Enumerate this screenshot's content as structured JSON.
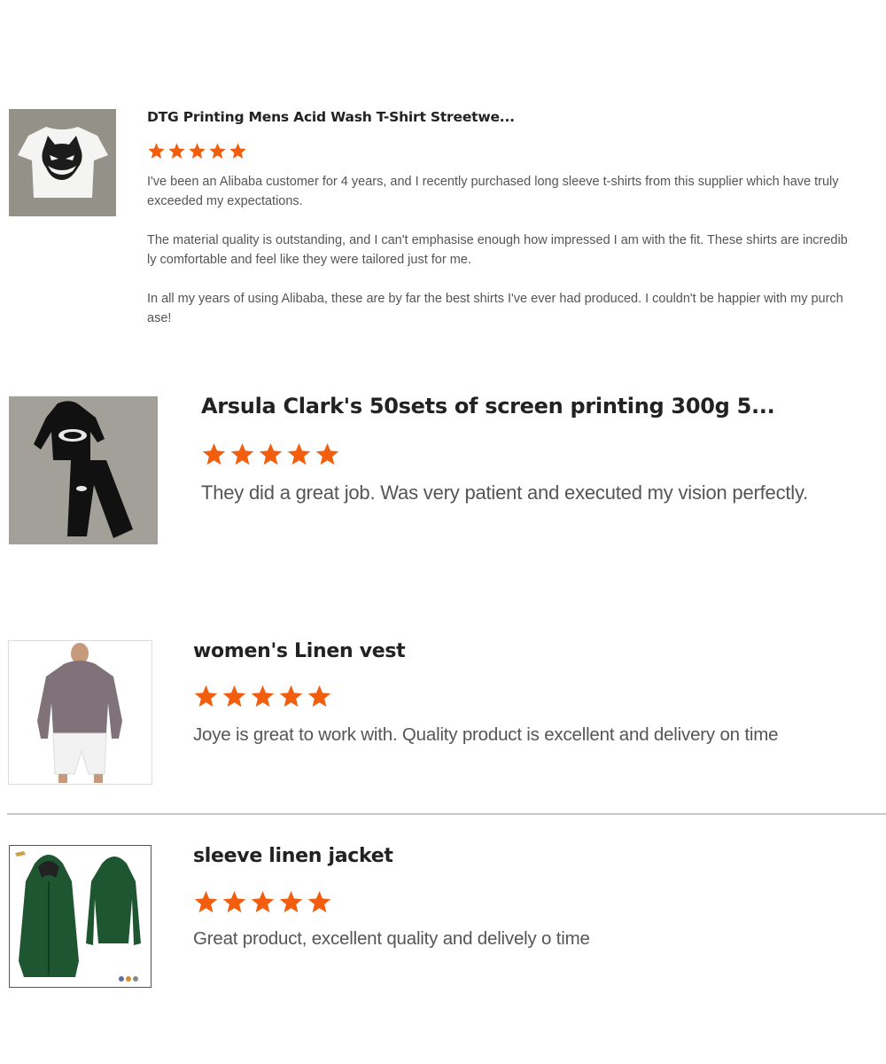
{
  "star_color": "#f25d0e",
  "reviews": [
    {
      "title": "DTG Printing Mens Acid Wash T-Shirt Streetwe...",
      "rating": 5,
      "image": "acid-wash-tshirt-image",
      "paragraphs": [
        "I've been an Alibaba customer for 4 years, and I recently purchased long sleeve t-shirts from this supplier which have truly exceeded my expectations.",
        "The material quality is outstanding, and I can't emphasise enough how impressed I am with the fit. These shirts are incredibly comfortable and feel like they were tailored just for me.",
        "In all my years of using Alibaba, these are by far the best shirts I've ever had produced. I couldn't be happier with my purchase!"
      ]
    },
    {
      "title": "Arsula Clark's 50sets of screen printing 300g 5...",
      "rating": 5,
      "image": "black-tracksuit-image",
      "text": "They did a great job. Was very patient and executed my vision perfectly."
    },
    {
      "title": "women's Linen vest",
      "rating": 5,
      "image": "grey-cropped-hoodie-image",
      "text": "Joye is great to work with. Quality product is excellent and delivery on time"
    },
    {
      "title": "sleeve linen jacket",
      "rating": 5,
      "image": "green-hooded-jacket-image",
      "text": "Great product, excellent quality and delively o time"
    }
  ]
}
